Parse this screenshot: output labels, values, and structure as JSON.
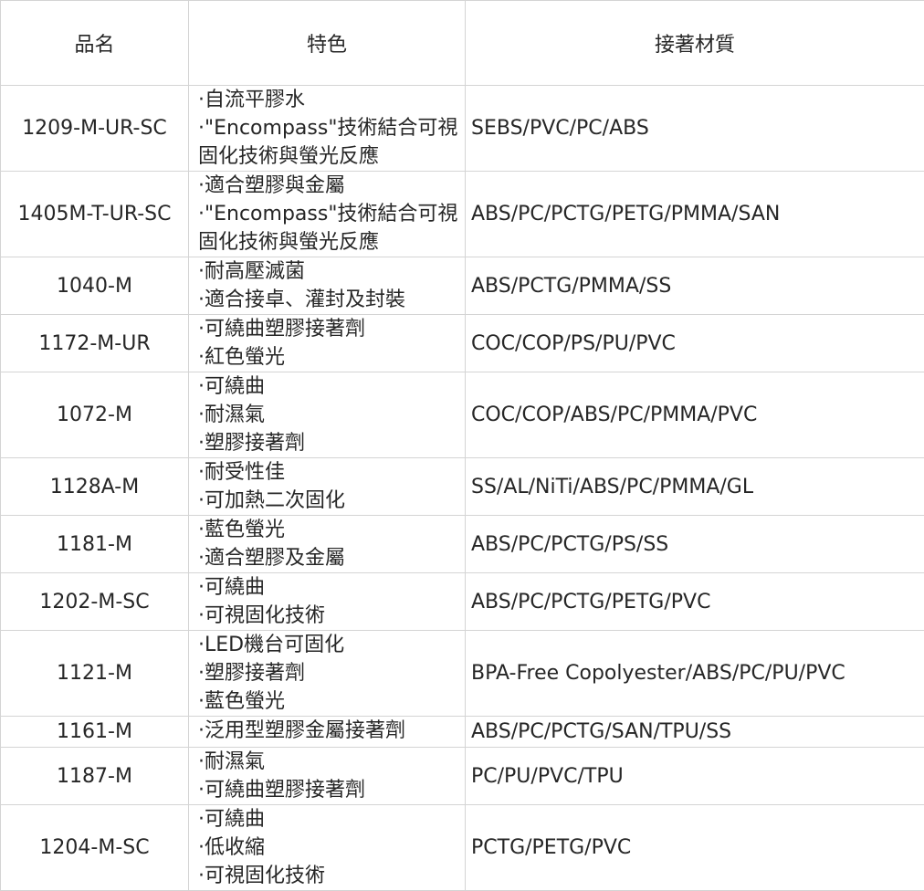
{
  "headers": {
    "name": "品名",
    "features": "特色",
    "materials": "接著材質"
  },
  "rows": [
    {
      "name": "1209-M-UR-SC",
      "features": [
        "·自流平膠水",
        "·\"Encompass\"技術結合可視",
        "固化技術與螢光反應"
      ],
      "materials": "SEBS/PVC/PC/ABS"
    },
    {
      "name": "1405M-T-UR-SC",
      "features": [
        "·適合塑膠與金屬",
        "·\"Encompass\"技術結合可視",
        "固化技術與螢光反應"
      ],
      "materials": "ABS/PC/PCTG/PETG/PMMA/SAN"
    },
    {
      "name": "1040-M",
      "features": [
        "·耐高壓滅菌",
        "·適合接卓、灌封及封裝"
      ],
      "materials": "ABS/PCTG/PMMA/SS"
    },
    {
      "name": "1172-M-UR",
      "features": [
        "·可繞曲塑膠接著劑",
        "·紅色螢光"
      ],
      "materials": "COC/COP/PS/PU/PVC"
    },
    {
      "name": "1072-M",
      "features": [
        "·可繞曲",
        "·耐濕氣",
        "·塑膠接著劑"
      ],
      "materials": "COC/COP/ABS/PC/PMMA/PVC"
    },
    {
      "name": "1128A-M",
      "features": [
        "·耐受性佳",
        "·可加熱二次固化"
      ],
      "materials": "SS/AL/NiTi/ABS/PC/PMMA/GL"
    },
    {
      "name": "1181-M",
      "features": [
        "·藍色螢光",
        "·適合塑膠及金屬"
      ],
      "materials": "ABS/PC/PCTG/PS/SS"
    },
    {
      "name": "1202-M-SC",
      "features": [
        "·可繞曲",
        "·可視固化技術"
      ],
      "materials": "ABS/PC/PCTG/PETG/PVC"
    },
    {
      "name": "1121-M",
      "features": [
        "·LED機台可固化",
        "·塑膠接著劑",
        "·藍色螢光"
      ],
      "materials": "BPA-Free Copolyester/ABS/PC/PU/PVC"
    },
    {
      "name": "1161-M",
      "features": [
        "·泛用型塑膠金屬接著劑"
      ],
      "materials": "ABS/PC/PCTG/SAN/TPU/SS"
    },
    {
      "name": "1187-M",
      "features": [
        "·耐濕氣",
        "·可繞曲塑膠接著劑"
      ],
      "materials": "PC/PU/PVC/TPU"
    },
    {
      "name": "1204-M-SC",
      "features": [
        "·可繞曲",
        "·低收縮",
        "·可視固化技術"
      ],
      "materials": "PCTG/PETG/PVC"
    }
  ]
}
